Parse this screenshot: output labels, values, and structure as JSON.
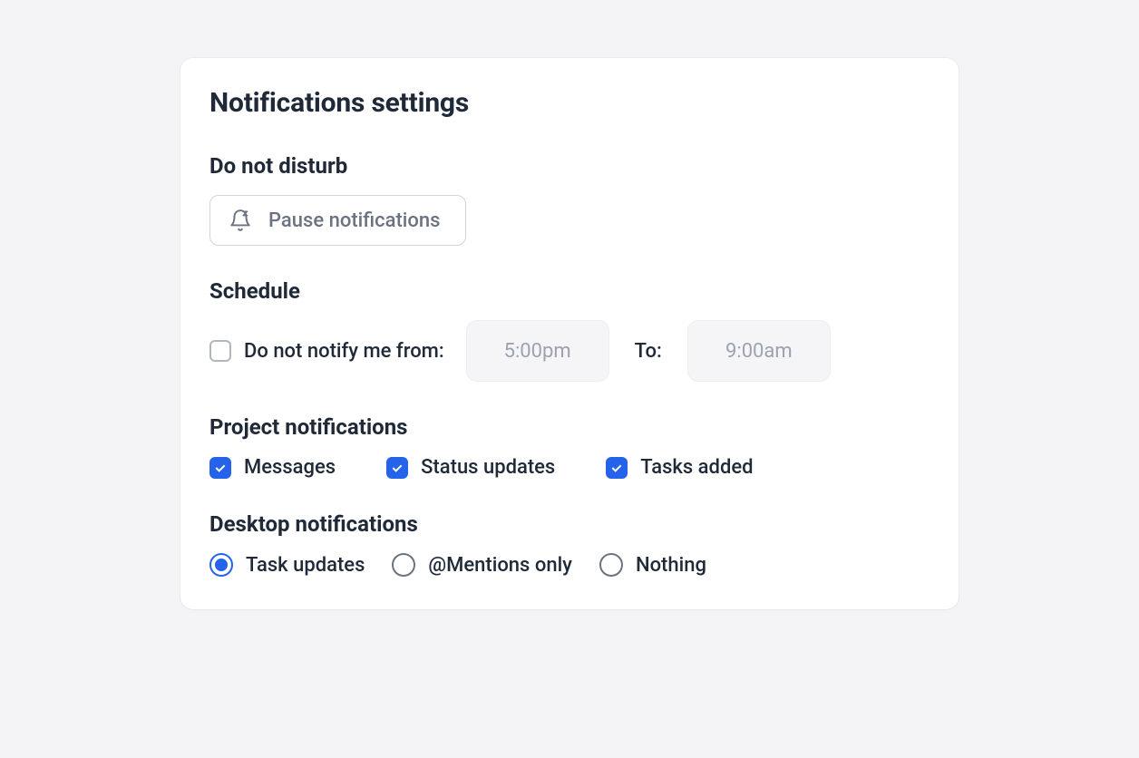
{
  "title": "Notifications settings",
  "dnd": {
    "heading": "Do not disturb",
    "pause_label": "Pause notifications"
  },
  "schedule": {
    "heading": "Schedule",
    "checkbox_label": "Do not notify me from:",
    "checkbox_checked": false,
    "from_value": "5:00pm",
    "to_label": "To:",
    "to_value": "9:00am"
  },
  "project": {
    "heading": "Project notifications",
    "options": [
      {
        "label": "Messages",
        "checked": true
      },
      {
        "label": "Status updates",
        "checked": true
      },
      {
        "label": "Tasks added",
        "checked": true
      }
    ]
  },
  "desktop": {
    "heading": "Desktop notifications",
    "options": [
      {
        "label": "Task updates",
        "selected": true
      },
      {
        "label": "@Mentions only",
        "selected": false
      },
      {
        "label": "Nothing",
        "selected": false
      }
    ]
  }
}
